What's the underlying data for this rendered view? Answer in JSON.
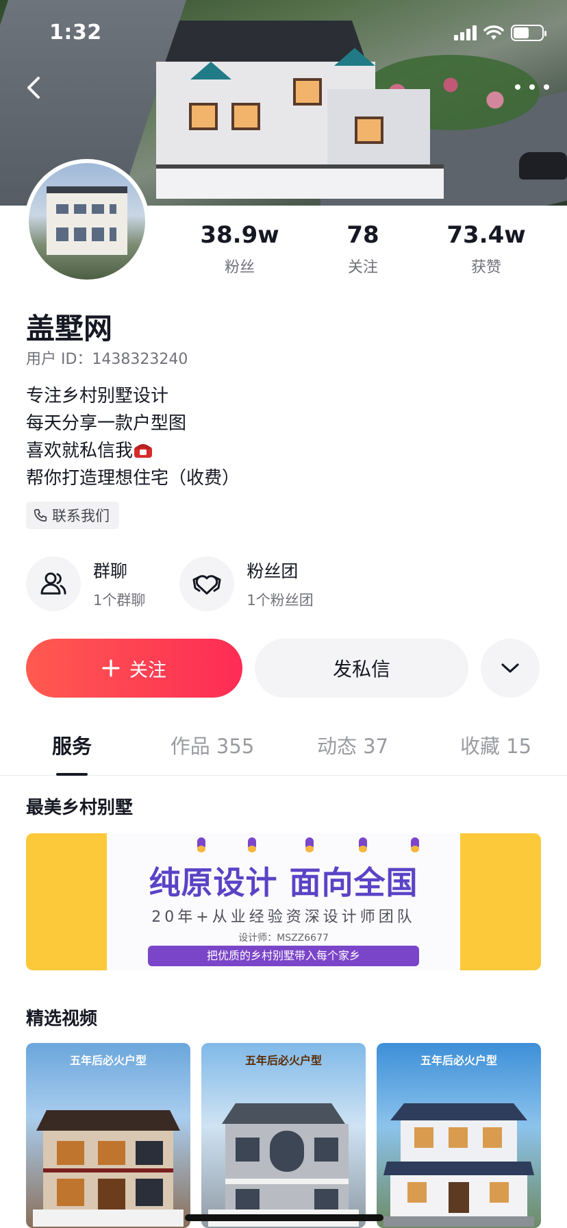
{
  "status_bar": {
    "time": "1:32"
  },
  "profile": {
    "name": "盖墅网",
    "user_id": "用户 ID：1438323240",
    "bio": [
      "专注乡村别墅设计",
      "每天分享一款户型图",
      "喜欢就私信我",
      "帮你打造理想住宅（收费）"
    ],
    "contact_label": "联系我们"
  },
  "stats": [
    {
      "value": "38.9w",
      "label": "粉丝"
    },
    {
      "value": "78",
      "label": "关注"
    },
    {
      "value": "73.4w",
      "label": "获赞"
    }
  ],
  "groups": [
    {
      "title": "群聊",
      "subtitle": "1个群聊",
      "icon": "people-icon"
    },
    {
      "title": "粉丝团",
      "subtitle": "1个粉丝团",
      "icon": "heart-badge-icon"
    }
  ],
  "actions": {
    "follow": "关注",
    "message": "发私信",
    "more_icon": "chevron-down-icon"
  },
  "tabs": [
    {
      "label": "服务",
      "active": true
    },
    {
      "label": "作品 355",
      "active": false
    },
    {
      "label": "动态 37",
      "active": false
    },
    {
      "label": "收藏 15",
      "active": false
    }
  ],
  "sections": {
    "featured_title": "最美乡村别墅",
    "banner": {
      "headline": "纯原设计 面向全国",
      "subline": "20年+从业经验资深设计师团队",
      "designer": "设计师：MSZZ6677",
      "ribbon": "把优质的乡村别墅带入每个家乡"
    },
    "videos_title": "精选视频",
    "videos": [
      {
        "caption": "五年后必火户型"
      },
      {
        "caption": "五年后必火户型"
      },
      {
        "caption": "五年后必火户型"
      }
    ]
  },
  "colors": {
    "accent": "#fd2c55",
    "accent_start": "#ff5a50",
    "banner_yellow": "#fbc93a",
    "banner_purple": "#5b43c6"
  }
}
